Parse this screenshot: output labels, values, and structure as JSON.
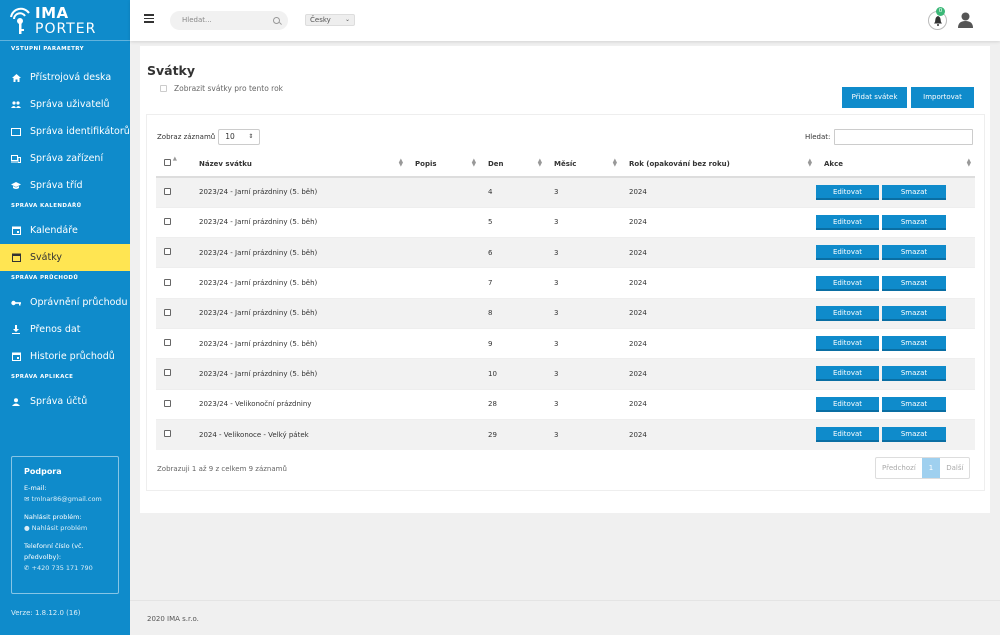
{
  "brand": {
    "line1": "IMA",
    "line2": "PORTER"
  },
  "sidebar": {
    "sections": [
      {
        "title": "VSTUPNÍ PARAMETRY",
        "items": [
          {
            "label": "Přístrojová deska",
            "icon": "home-icon"
          },
          {
            "label": "Správa uživatelů",
            "icon": "users-icon"
          },
          {
            "label": "Správa identifikátorů",
            "icon": "card-icon"
          },
          {
            "label": "Správa zařízení",
            "icon": "devices-icon"
          },
          {
            "label": "Správa tříd",
            "icon": "graduation-cap-icon"
          }
        ]
      },
      {
        "title": "SPRÁVA KALENDÁŘŮ",
        "items": [
          {
            "label": "Kalendáře",
            "icon": "calendar-icon"
          },
          {
            "label": "Svátky",
            "icon": "calendar-icon",
            "active": true
          }
        ]
      },
      {
        "title": "SPRÁVA PRŮCHODŮ",
        "items": [
          {
            "label": "Oprávnění průchodu",
            "icon": "key-icon"
          },
          {
            "label": "Přenos dat",
            "icon": "download-icon"
          },
          {
            "label": "Historie průchodů",
            "icon": "calendar-icon"
          }
        ]
      },
      {
        "title": "SPRÁVA APLIKACE",
        "items": [
          {
            "label": "Správa účtů",
            "icon": "user-icon"
          }
        ]
      }
    ],
    "support": {
      "title": "Podpora",
      "email_label": "E-mail:",
      "email": "tmlnar86@gmail.com",
      "report_label": "Nahlásit problém:",
      "report_link": "Nahlásit problém",
      "phone_label": "Telefonní číslo (vč. předvolby):",
      "phone": "+420 735 171 790"
    },
    "version": "Verze: 1.8.12.0 (16)"
  },
  "topbar": {
    "search_placeholder": "Hledat...",
    "language": "Česky",
    "notifications_count": "0"
  },
  "page": {
    "title": "Svátky",
    "show_all_label": "Zobrazit svátky pro tento rok",
    "add_button": "Přidat svátek",
    "import_button": "Importovat",
    "length_label": "Zobraz záznamů",
    "length_value": "10",
    "filter_label": "Hledat:",
    "columns": [
      "Název svátku",
      "Popis",
      "Den",
      "Měsíc",
      "Rok (opakování bez roku)",
      "Akce"
    ],
    "edit_label": "Editovat",
    "delete_label": "Smazat",
    "rows": [
      {
        "name": "2023/24 - Jarní prázdniny (5. běh)",
        "desc": "",
        "day": "4",
        "month": "3",
        "year": "2024"
      },
      {
        "name": "2023/24 - Jarní prázdniny (5. běh)",
        "desc": "",
        "day": "5",
        "month": "3",
        "year": "2024"
      },
      {
        "name": "2023/24 - Jarní prázdniny (5. běh)",
        "desc": "",
        "day": "6",
        "month": "3",
        "year": "2024"
      },
      {
        "name": "2023/24 - Jarní prázdniny (5. běh)",
        "desc": "",
        "day": "7",
        "month": "3",
        "year": "2024"
      },
      {
        "name": "2023/24 - Jarní prázdniny (5. běh)",
        "desc": "",
        "day": "8",
        "month": "3",
        "year": "2024"
      },
      {
        "name": "2023/24 - Jarní prázdniny (5. běh)",
        "desc": "",
        "day": "9",
        "month": "3",
        "year": "2024"
      },
      {
        "name": "2023/24 - Jarní prázdniny (5. běh)",
        "desc": "",
        "day": "10",
        "month": "3",
        "year": "2024"
      },
      {
        "name": "2023/24 - Velikonoční prázdniny",
        "desc": "",
        "day": "28",
        "month": "3",
        "year": "2024"
      },
      {
        "name": "2024 - Velikonoce - Velký pátek",
        "desc": "",
        "day": "29",
        "month": "3",
        "year": "2024"
      }
    ],
    "info": "Zobrazuji 1 až 9 z celkem 9 záznamů",
    "pager": {
      "prev": "Předchozí",
      "current": "1",
      "next": "Další"
    }
  },
  "footer": "2020 IMA s.r.o."
}
